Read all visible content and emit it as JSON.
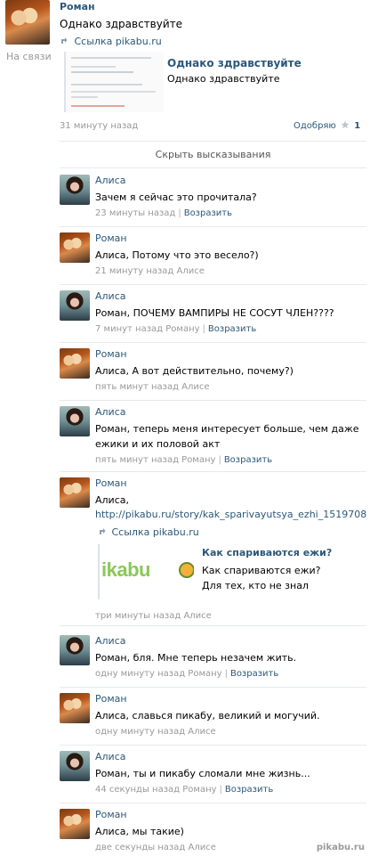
{
  "post": {
    "author": "Роман",
    "status": "На связи",
    "text": "Однако здравствуйте",
    "link_label": "Ссылка pikabu.ru",
    "preview_title": "Однако здравствуйте",
    "preview_text": "Однако здравствуйте",
    "time": "31 минуту назад",
    "like_label": "Одобряю",
    "like_count": "1"
  },
  "hide_label": "Скрыть высказывания",
  "comments": [
    {
      "author": "Алиса",
      "text": "Зачем я сейчас это прочитала?",
      "time": "23 минуты назад",
      "reply": "Возразить"
    },
    {
      "author": "Роман",
      "text": "Алиса, Потому что это весело?)",
      "time": "21 минуту назад Алисе",
      "reply": ""
    },
    {
      "author": "Алиса",
      "text": "Роман, ПОЧЕМУ ВАМПИРЫ НЕ СОСУТ ЧЛЕН????",
      "time": "7 минут назад Роману",
      "reply": "Возразить"
    },
    {
      "author": "Роман",
      "text": "Алиса, А вот действительно, почему?)",
      "time": "пять минут назад Алисе",
      "reply": ""
    },
    {
      "author": "Алиса",
      "text": "Роман, теперь меня интересует больше, чем даже ежики и их половой акт",
      "time": "пять минут назад Роману",
      "reply": "Возразить"
    },
    {
      "author": "Роман",
      "text": "Алиса,",
      "url": "http://pikabu.ru/story/kak_sparivayutsya_ezhi_1519708",
      "link_label": "Ссылка pikabu.ru",
      "preview_title": "Как спариваются ежи?",
      "preview_text": "Как спариваются ежи? Для тех, кто не знал",
      "preview_logo": "ikabu",
      "time": "три минуты назад Алисе",
      "reply": ""
    },
    {
      "author": "Алиса",
      "text": "Роман, бля. Мне теперь незачем жить.",
      "time": "одну минуту назад Роману",
      "reply": "Возразить"
    },
    {
      "author": "Роман",
      "text": "Алиса, славься пикабу, великий и могучий.",
      "time": "одну минуту назад Алисе",
      "reply": ""
    },
    {
      "author": "Алиса",
      "text": "Роман, ты и пикабу сломали мне жизнь...",
      "time": "44 секунды назад Роману",
      "reply": "Возразить"
    },
    {
      "author": "Роман",
      "text": "Алиса, мы такие)",
      "time": "две секунды назад Алисе",
      "reply": ""
    }
  ],
  "watermark": "pikabu.ru",
  "colors": {
    "link": "#2b587a",
    "meta": "#999999",
    "divider": "#e7eaed"
  }
}
